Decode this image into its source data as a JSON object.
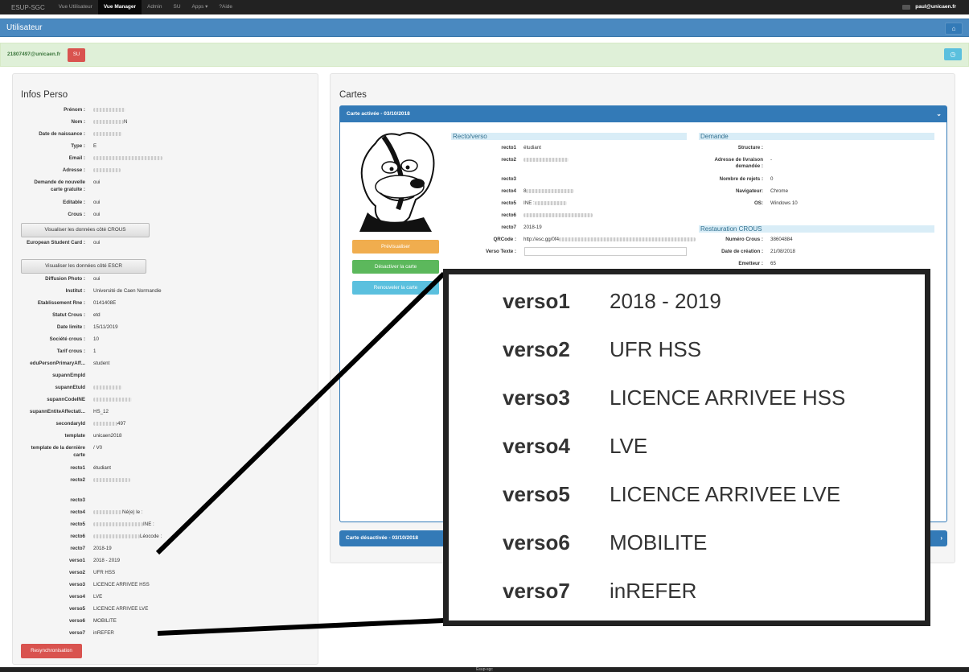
{
  "nav": {
    "brand": "ESUP-SGC",
    "items": [
      "Vue Utilisateur",
      "Vue Manager",
      "Admin",
      "SU",
      "Apps ▾",
      "Aide"
    ],
    "user": "paul@unicaen.fr"
  },
  "title": "Utilisateur",
  "userbar": {
    "login": "21807497@unicaen.fr",
    "su_label": "SU"
  },
  "infos": {
    "heading": "Infos Perso",
    "rows": [
      {
        "label": "Prénom :",
        "value": ""
      },
      {
        "label": "Nom :",
        "value": "N"
      },
      {
        "label": "Date de naissance :",
        "value": ""
      },
      {
        "label": "Type :",
        "value": "E"
      },
      {
        "label": "Email :",
        "value": ""
      },
      {
        "label": "Adresse :",
        "value": ""
      },
      {
        "label": "Demande de nouvelle carte gratuite :",
        "value": "oui"
      },
      {
        "label": "Editable :",
        "value": "oui"
      },
      {
        "label": "Crous :",
        "value": "oui"
      },
      {
        "label": "European Student Card :",
        "value": "oui"
      },
      {
        "label": "Diffusion Photo :",
        "value": "oui"
      },
      {
        "label": "Institut :",
        "value": "Université de Caen Normandie"
      },
      {
        "label": "Etablissement Rne :",
        "value": "0141408E"
      },
      {
        "label": "Statut Crous :",
        "value": "etd"
      },
      {
        "label": "Date limite :",
        "value": "15/11/2019"
      },
      {
        "label": "Société crous :",
        "value": "10"
      },
      {
        "label": "Tarif crous :",
        "value": "1"
      },
      {
        "label": "eduPersonPrimaryAff...",
        "value": "student"
      },
      {
        "label": "supannEmpId",
        "value": ""
      },
      {
        "label": "supannEtuId",
        "value": ""
      },
      {
        "label": "supannCodeINE",
        "value": ""
      },
      {
        "label": "supannEntiteAffectati...",
        "value": "HS_12"
      },
      {
        "label": "secondaryId",
        "value": "497"
      },
      {
        "label": "template",
        "value": "unicaen2018"
      },
      {
        "label": "template de la dernière carte",
        "value": "/ V0"
      },
      {
        "label": "recto1",
        "value": "étudiant"
      },
      {
        "label": "recto2",
        "value": ""
      },
      {
        "label": "recto3",
        "value": ""
      },
      {
        "label": "recto4",
        "value": "Né(e) le :"
      },
      {
        "label": "recto5",
        "value": "INE :"
      },
      {
        "label": "recto6",
        "value": "Léocode :"
      },
      {
        "label": "recto7",
        "value": "2018-19"
      },
      {
        "label": "verso1",
        "value": "2018 - 2019"
      },
      {
        "label": "verso2",
        "value": "UFR HSS"
      },
      {
        "label": "verso3",
        "value": "LICENCE ARRIVEE HSS"
      },
      {
        "label": "verso4",
        "value": "LVE"
      },
      {
        "label": "verso5",
        "value": "LICENCE ARRIVEE LVE"
      },
      {
        "label": "verso6",
        "value": "MOBILITE"
      },
      {
        "label": "verso7",
        "value": "inREFER"
      }
    ],
    "btn_crous": "Visualiser les données côté CROUS",
    "btn_escr": "Visualiser les données côté ESCR",
    "btn_resync": "Resynchronisation"
  },
  "cartes": {
    "heading": "Cartes",
    "active_title": "Carte activée - 03/10/2018",
    "inactive_title": "Carte désactivée - 03/10/2018",
    "btn_preview": "Prévisualiser",
    "btn_deactivate": "Désactiver la carte",
    "btn_renew": "Renouveler la carte",
    "recto_heading": "Recto/verso",
    "recto": [
      {
        "k": "recto1",
        "v": "étudiant"
      },
      {
        "k": "recto2",
        "v": ""
      },
      {
        "k": "recto3",
        "v": ""
      },
      {
        "k": "recto4",
        "v": "8"
      },
      {
        "k": "recto5",
        "v": "INE :"
      },
      {
        "k": "recto6",
        "v": ""
      },
      {
        "k": "recto7",
        "v": "2018-19"
      },
      {
        "k": "QRCode :",
        "v": "http://esc.gg/0f4"
      },
      {
        "k": "Verso Texte :",
        "v": ""
      }
    ],
    "demande_heading": "Demande",
    "demande": [
      {
        "k": "Structure :",
        "v": ""
      },
      {
        "k": "Adresse de livraison demandée :",
        "v": "-"
      },
      {
        "k": "Nombre de rejets :",
        "v": "0"
      },
      {
        "k": "Navigateur:",
        "v": "Chrome"
      },
      {
        "k": "OS:",
        "v": "Windows 10"
      }
    ],
    "crous_heading": "Restauration CROUS",
    "crous": [
      {
        "k": "Numéro Crous :",
        "v": "38604884"
      },
      {
        "k": "Date de création :",
        "v": "21/08/2018"
      },
      {
        "k": "Emetteur :",
        "v": "65"
      }
    ]
  },
  "zoom": [
    {
      "k": "verso1",
      "v": "2018 - 2019"
    },
    {
      "k": "verso2",
      "v": "UFR HSS"
    },
    {
      "k": "verso3",
      "v": "LICENCE ARRIVEE HSS"
    },
    {
      "k": "verso4",
      "v": "LVE"
    },
    {
      "k": "verso5",
      "v": "LICENCE ARRIVEE LVE"
    },
    {
      "k": "verso6",
      "v": "MOBILITE"
    },
    {
      "k": "verso7",
      "v": "inREFER"
    }
  ],
  "footer": "Esup-sgc",
  "colors": {
    "navbar": "#222222",
    "title_bar": "#4a89c0",
    "primary": "#337ab7",
    "danger": "#d9534f",
    "warning": "#f0ad4e",
    "success": "#5cb85c",
    "info": "#5bc0de"
  }
}
